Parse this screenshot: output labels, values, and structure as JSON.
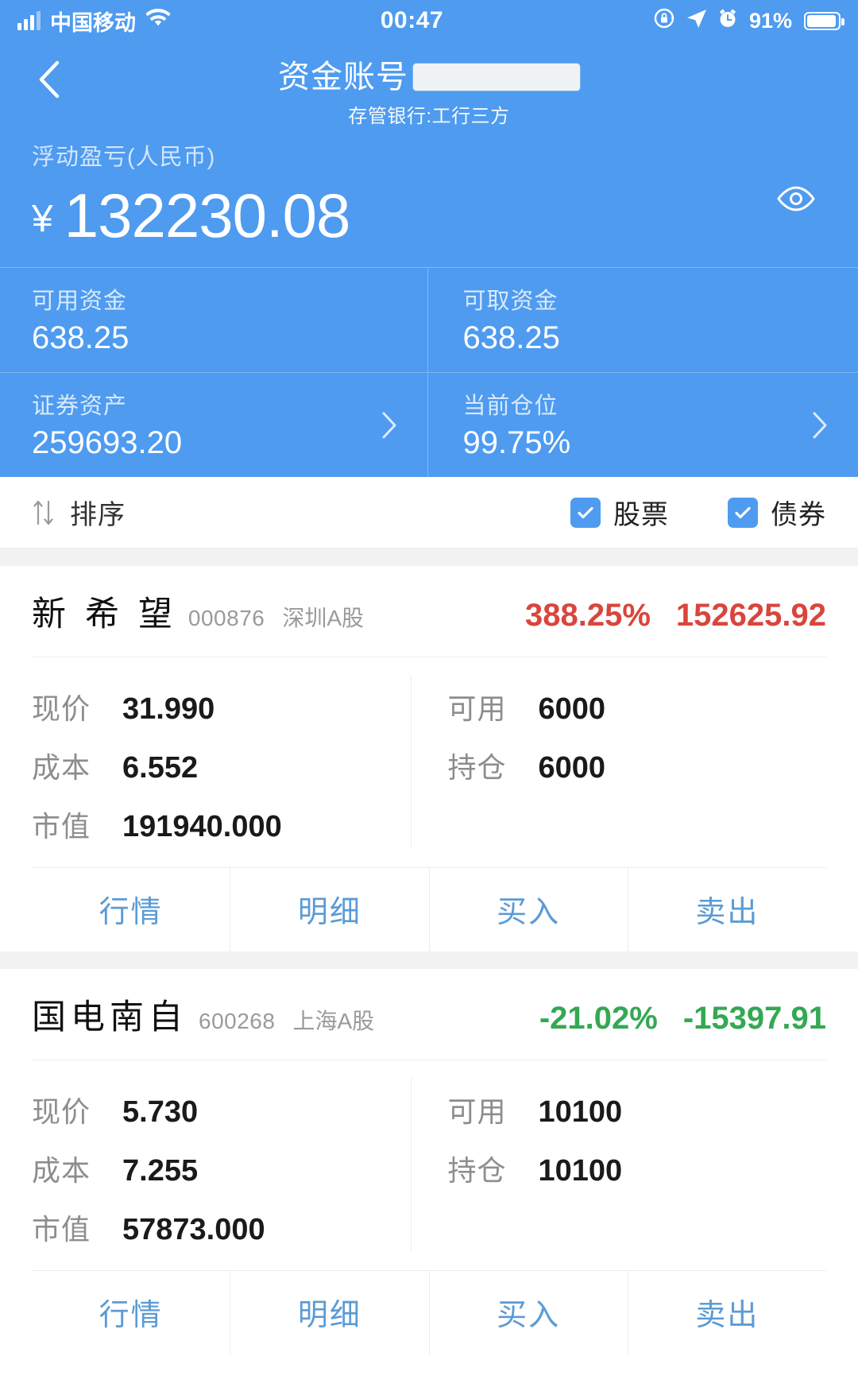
{
  "status_bar": {
    "carrier": "中国移动",
    "time": "00:47",
    "battery_percent": "91%",
    "icons": [
      "signal-bars-icon",
      "wifi-icon",
      "rotation-lock-icon",
      "location-arrow-icon",
      "alarm-clock-icon",
      "battery-icon"
    ]
  },
  "nav": {
    "back_icon": "chevron-left-icon",
    "title": "资金账号",
    "account_masked": "",
    "subtitle": "存管银行:工行三方"
  },
  "summary": {
    "profit_label": "浮动盈亏(人民币)",
    "currency_symbol": "¥",
    "profit_value": "132230.08",
    "eye_icon": "eye-icon",
    "stats": [
      {
        "label": "可用资金",
        "value": "638.25",
        "has_chevron": false
      },
      {
        "label": "可取资金",
        "value": "638.25",
        "has_chevron": false
      },
      {
        "label": "证券资产",
        "value": "259693.20",
        "has_chevron": true
      },
      {
        "label": "当前仓位",
        "value": "99.75%",
        "has_chevron": true
      }
    ]
  },
  "filter_bar": {
    "sort_icon": "sort-arrows-icon",
    "sort_label": "排序",
    "checkboxes": [
      {
        "label": "股票",
        "checked": true
      },
      {
        "label": "债券",
        "checked": true
      }
    ]
  },
  "actions": {
    "quote": "行情",
    "detail": "明细",
    "buy": "买入",
    "sell": "卖出"
  },
  "labels": {
    "price": "现价",
    "cost": "成本",
    "market_value": "市值",
    "available": "可用",
    "position": "持仓"
  },
  "holdings": [
    {
      "name": "新 希 望",
      "code": "000876",
      "market": "深圳A股",
      "pct": "388.25%",
      "pl": "152625.92",
      "direction": "up",
      "price": "31.990",
      "cost": "6.552",
      "market_value": "191940.000",
      "available": "6000",
      "position": "6000"
    },
    {
      "name": "国电南自",
      "code": "600268",
      "market": "上海A股",
      "pct": "-21.02%",
      "pl": "-15397.91",
      "direction": "down",
      "price": "5.730",
      "cost": "7.255",
      "market_value": "57873.000",
      "available": "10100",
      "position": "10100"
    }
  ],
  "colors": {
    "brand_blue": "#4e9bf0",
    "up_red": "#d9453c",
    "down_green": "#34a853",
    "link_blue": "#5b9bd5"
  }
}
